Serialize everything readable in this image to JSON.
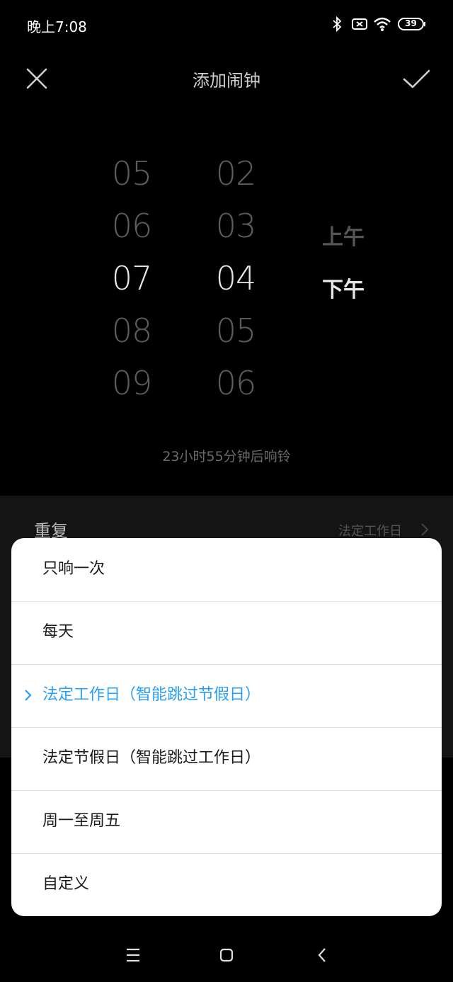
{
  "status_bar": {
    "time": "晚上7:08",
    "battery": "39",
    "icons": [
      "bluetooth-icon",
      "sim-off-icon",
      "wifi-icon",
      "battery-icon"
    ]
  },
  "header": {
    "title": "添加闹钟",
    "close_icon": "close-icon",
    "confirm_icon": "check-icon"
  },
  "picker": {
    "hours": [
      "05",
      "06",
      "07",
      "08",
      "09"
    ],
    "selected_hour": "07",
    "minutes": [
      "02",
      "03",
      "04",
      "05",
      "06"
    ],
    "selected_minute": "04",
    "am": "上午",
    "pm": "下午",
    "selected_period": "下午"
  },
  "ring_info": "23小时55分钟后响铃",
  "settings": {
    "repeat_label": "重复",
    "repeat_value": "法定工作日"
  },
  "repeat_dialog": {
    "options": [
      {
        "label": "只响一次",
        "selected": false
      },
      {
        "label": "每天",
        "selected": false
      },
      {
        "label": "法定工作日（智能跳过节假日）",
        "selected": true
      },
      {
        "label": "法定节假日（智能跳过工作日）",
        "selected": false
      },
      {
        "label": "周一至周五",
        "selected": false
      },
      {
        "label": "自定义",
        "selected": false
      }
    ],
    "accent_color": "#2a9df4"
  },
  "nav_bar": {
    "icons": [
      "menu-icon",
      "home-icon",
      "back-icon"
    ]
  }
}
